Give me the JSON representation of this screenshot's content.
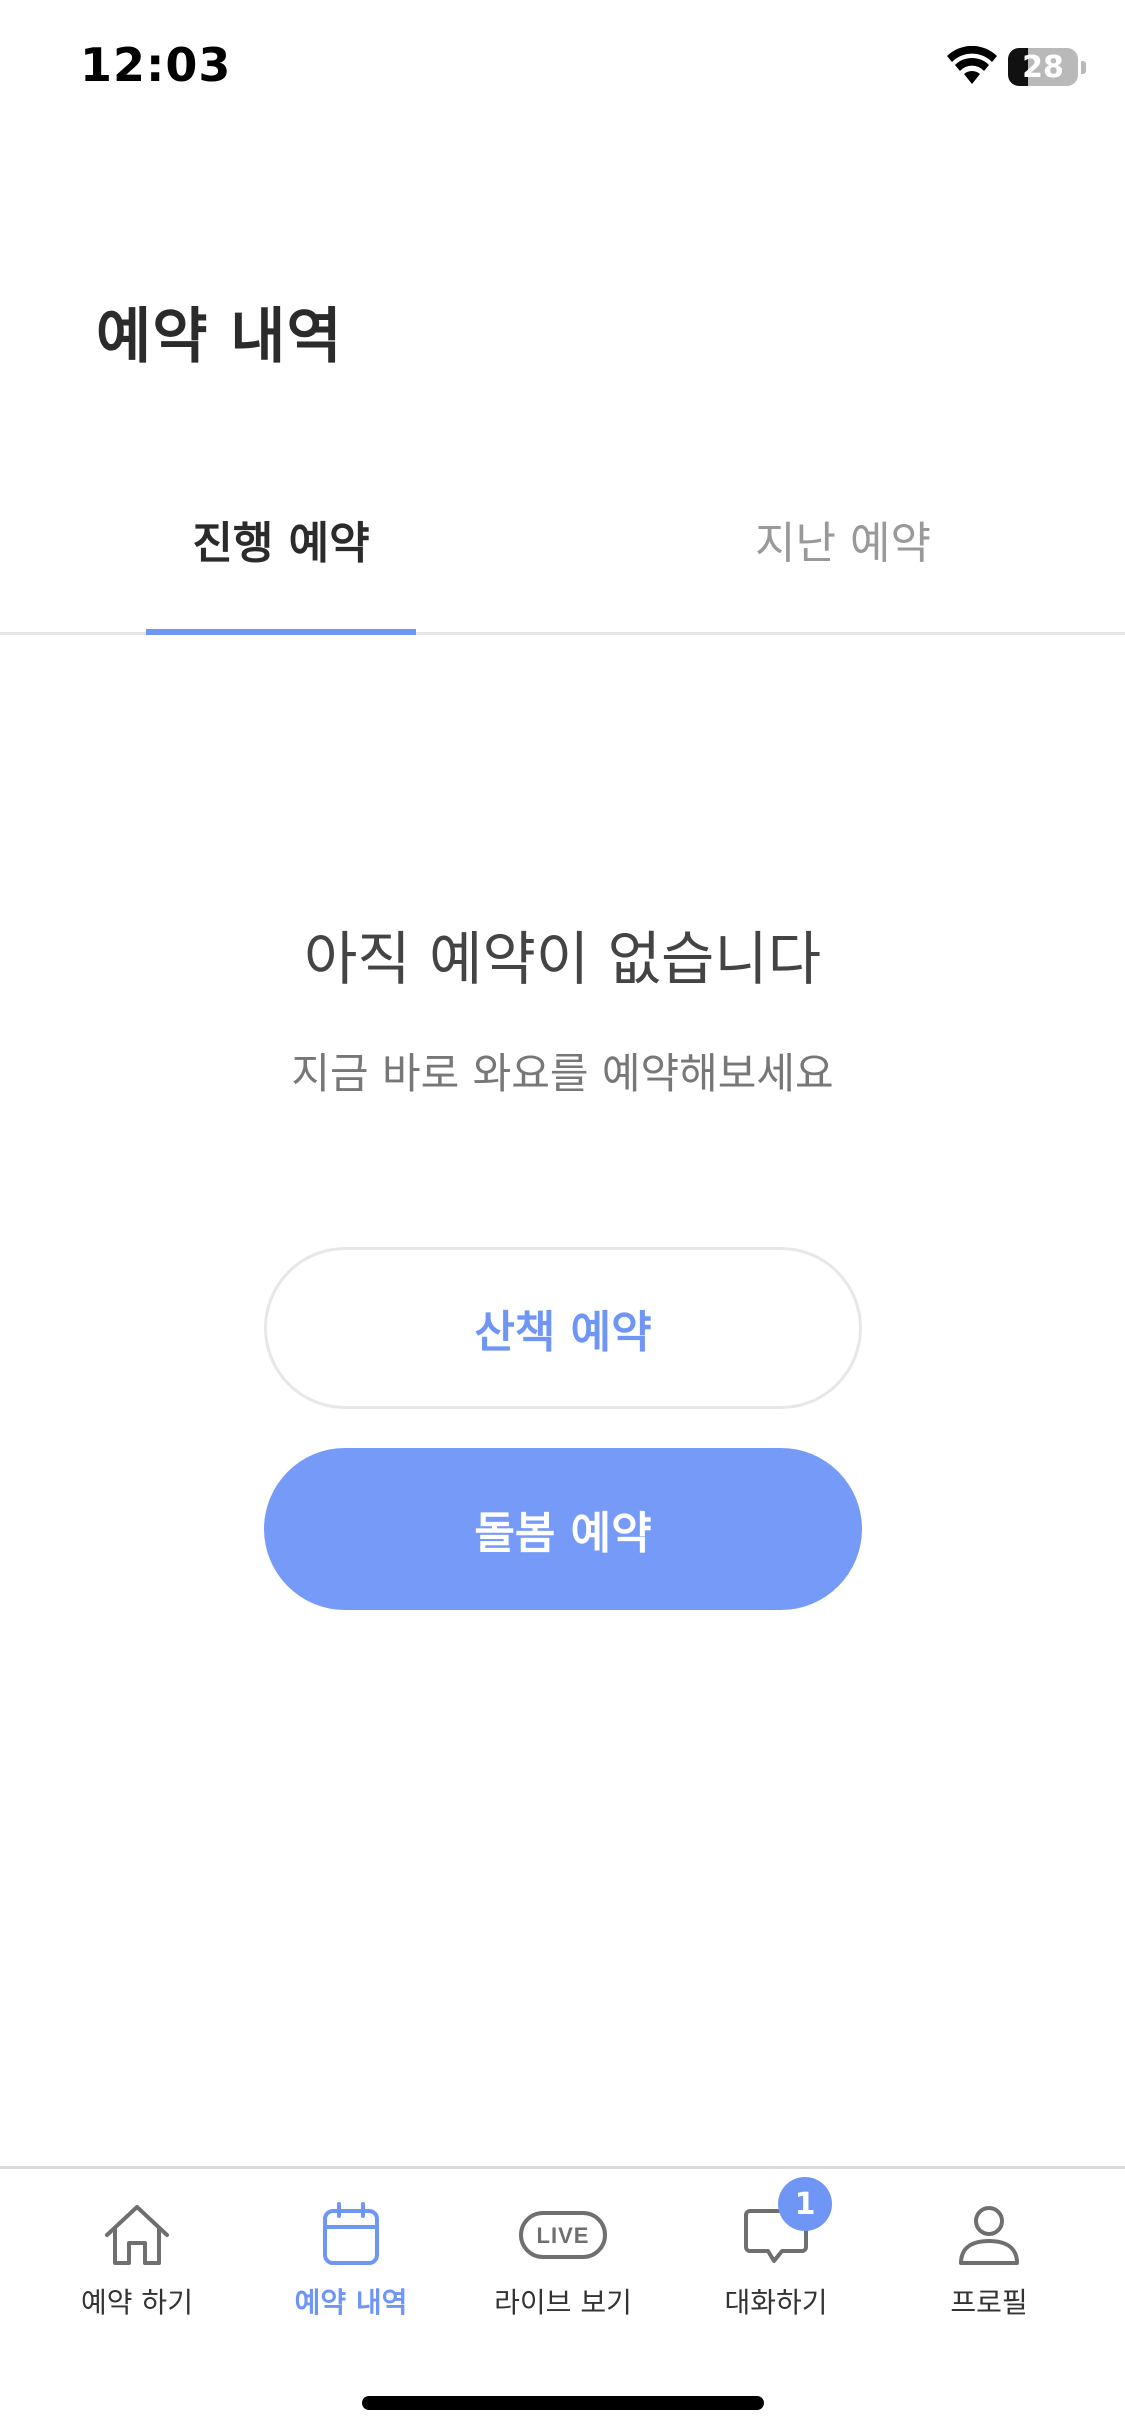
{
  "status_bar": {
    "time": "12:03",
    "battery": "28",
    "battery_level": 0.28
  },
  "page": {
    "title": "예약 내역"
  },
  "tabs": [
    {
      "label": "진행 예약",
      "active": true
    },
    {
      "label": "지난 예약",
      "active": false
    }
  ],
  "empty_state": {
    "title": "아직 예약이 없습니다",
    "subtitle": "지금 바로 와요를 예약해보세요"
  },
  "buttons": {
    "walk": "산책 예약",
    "care": "돌봄 예약"
  },
  "bottom_nav": [
    {
      "label": "예약 하기",
      "icon": "home-icon",
      "active": false
    },
    {
      "label": "예약 내역",
      "icon": "calendar-icon",
      "active": true
    },
    {
      "label": "라이브 보기",
      "icon": "live-icon",
      "active": false
    },
    {
      "label": "대화하기",
      "icon": "chat-icon",
      "active": false,
      "badge": "1"
    },
    {
      "label": "프로필",
      "icon": "profile-icon",
      "active": false
    }
  ],
  "colors": {
    "accent": "#7096f5",
    "button_fill": "#769af7",
    "text_dark": "#2b2b2b",
    "text_muted": "#999999"
  }
}
